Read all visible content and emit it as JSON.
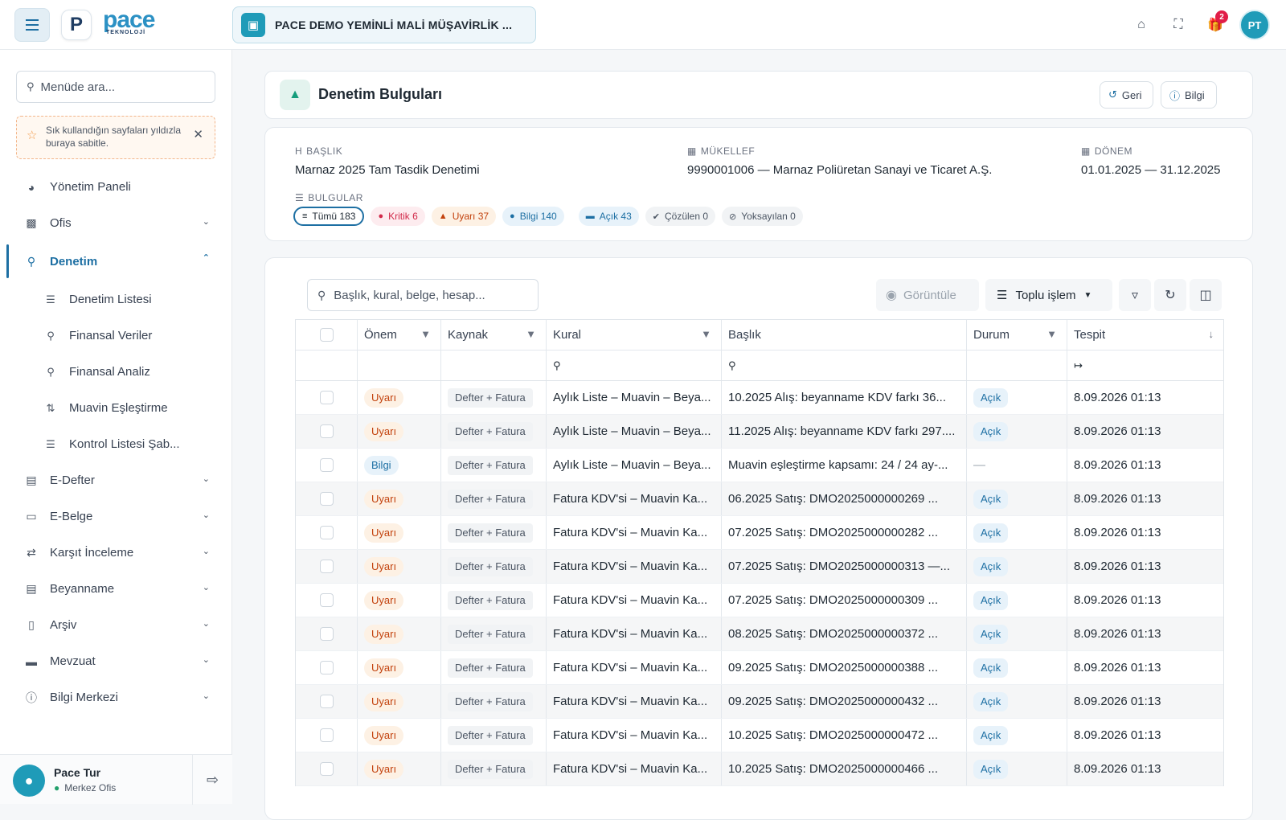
{
  "topbar": {
    "logo_letter": "P",
    "logo_word": "pace",
    "logo_sub": "TEKNOLOJİ",
    "company": "PACE DEMO YEMİNLİ MALİ MÜŞAVİRLİK ...",
    "notification_count": "2",
    "user_initials": "PT",
    "icons": [
      "menu-icon",
      "building-icon",
      "home-icon",
      "fullscreen-icon",
      "gift-icon"
    ]
  },
  "sidebar": {
    "search_placeholder": "Menüde ara...",
    "pin_note": "Sık kullandığın sayfaları yıldızla buraya sabitle.",
    "items": [
      {
        "label": "Yönetim Paneli",
        "icon": "gauge-icon"
      },
      {
        "label": "Ofis",
        "icon": "building-icon"
      },
      {
        "label": "Denetim",
        "icon": "search-analytics-icon"
      },
      {
        "label": "E-Defter",
        "icon": "book-icon"
      },
      {
        "label": "E-Belge",
        "icon": "file-icon"
      },
      {
        "label": "Karşıt İnceleme",
        "icon": "swap-icon"
      },
      {
        "label": "Beyanname",
        "icon": "file-text-icon"
      },
      {
        "label": "Arşiv",
        "icon": "archive-icon"
      },
      {
        "label": "Mevzuat",
        "icon": "folder-icon"
      },
      {
        "label": "Bilgi Merkezi",
        "icon": "info-icon"
      }
    ],
    "sub_items": [
      {
        "label": "Denetim Listesi",
        "icon": "list-icon"
      },
      {
        "label": "Finansal Veriler",
        "icon": "search-analytics-icon"
      },
      {
        "label": "Finansal Analiz",
        "icon": "search-analytics-icon"
      },
      {
        "label": "Muavin Eşleştirme",
        "icon": "match-icon"
      },
      {
        "label": "Kontrol Listesi Şab...",
        "icon": "list-icon"
      }
    ],
    "user": {
      "name": "Pace Tur",
      "office": "Merkez Ofis"
    }
  },
  "page": {
    "title": "Denetim Bulguları",
    "back_label": "Geri",
    "info_label": "Bilgi"
  },
  "summary": {
    "title_label": "BAŞLIK",
    "title_value": "Marnaz 2025 Tam Tasdik Denetimi",
    "taxpayer_label": "MÜKELLEF",
    "taxpayer_value": "9990001006 — Marnaz Poliüretan Sanayi ve Ticaret A.Ş.",
    "period_label": "DÖNEM",
    "period_value": "01.01.2025 — 31.12.2025",
    "findings_label": "BULGULAR",
    "chips": {
      "all": "Tümü 183",
      "critical": "Kritik 6",
      "warning": "Uyarı 37",
      "info": "Bilgi 140",
      "open": "Açık 43",
      "resolved": "Çözülen 0",
      "ignored": "Yoksayılan 0"
    }
  },
  "toolbar": {
    "search_placeholder": "Başlık, kural, belge, hesap...",
    "view_label": "Görüntüle",
    "bulk_label": "Toplu işlem"
  },
  "table": {
    "columns": [
      "Önem",
      "Kaynak",
      "Kural",
      "Başlık",
      "Durum",
      "Tespit"
    ],
    "rows": [
      {
        "severity": "Uyarı",
        "source": "Defter + Fatura",
        "rule": "Aylık Liste – Muavin – Beya...",
        "title": "10.2025 Alış: beyanname KDV farkı 36...",
        "status": "Açık",
        "detected": "8.09.2026 01:13"
      },
      {
        "severity": "Uyarı",
        "source": "Defter + Fatura",
        "rule": "Aylık Liste – Muavin – Beya...",
        "title": "11.2025 Alış: beyanname KDV farkı 297....",
        "status": "Açık",
        "detected": "8.09.2026 01:13"
      },
      {
        "severity": "Bilgi",
        "source": "Defter + Fatura",
        "rule": "Aylık Liste – Muavin – Beya...",
        "title": "Muavin eşleştirme kapsamı: 24 / 24 ay-...",
        "status": "—",
        "detected": "8.09.2026 01:13"
      },
      {
        "severity": "Uyarı",
        "source": "Defter + Fatura",
        "rule": "Fatura KDV'si – Muavin Ka...",
        "title": "06.2025 Satış: DMO2025000000269 ...",
        "status": "Açık",
        "detected": "8.09.2026 01:13"
      },
      {
        "severity": "Uyarı",
        "source": "Defter + Fatura",
        "rule": "Fatura KDV'si – Muavin Ka...",
        "title": "07.2025 Satış: DMO2025000000282 ...",
        "status": "Açık",
        "detected": "8.09.2026 01:13"
      },
      {
        "severity": "Uyarı",
        "source": "Defter + Fatura",
        "rule": "Fatura KDV'si – Muavin Ka...",
        "title": "07.2025 Satış: DMO2025000000313 —...",
        "status": "Açık",
        "detected": "8.09.2026 01:13"
      },
      {
        "severity": "Uyarı",
        "source": "Defter + Fatura",
        "rule": "Fatura KDV'si – Muavin Ka...",
        "title": "07.2025 Satış: DMO2025000000309 ...",
        "status": "Açık",
        "detected": "8.09.2026 01:13"
      },
      {
        "severity": "Uyarı",
        "source": "Defter + Fatura",
        "rule": "Fatura KDV'si – Muavin Ka...",
        "title": "08.2025 Satış: DMO2025000000372 ...",
        "status": "Açık",
        "detected": "8.09.2026 01:13"
      },
      {
        "severity": "Uyarı",
        "source": "Defter + Fatura",
        "rule": "Fatura KDV'si – Muavin Ka...",
        "title": "09.2025 Satış: DMO2025000000388 ...",
        "status": "Açık",
        "detected": "8.09.2026 01:13"
      },
      {
        "severity": "Uyarı",
        "source": "Defter + Fatura",
        "rule": "Fatura KDV'si – Muavin Ka...",
        "title": "09.2025 Satış: DMO2025000000432 ...",
        "status": "Açık",
        "detected": "8.09.2026 01:13"
      },
      {
        "severity": "Uyarı",
        "source": "Defter + Fatura",
        "rule": "Fatura KDV'si – Muavin Ka...",
        "title": "10.2025 Satış: DMO2025000000472 ...",
        "status": "Açık",
        "detected": "8.09.2026 01:13"
      },
      {
        "severity": "Uyarı",
        "source": "Defter + Fatura",
        "rule": "Fatura KDV'si – Muavin Ka...",
        "title": "10.2025 Satış: DMO2025000000466 ...",
        "status": "Açık",
        "detected": "8.09.2026 01:13"
      }
    ]
  },
  "colors": {
    "primary": "#1d6fa3",
    "brand": "#2c91c4",
    "teal": "#1f9bb8",
    "warning": "#c2410c",
    "critical": "#d12a4a"
  }
}
